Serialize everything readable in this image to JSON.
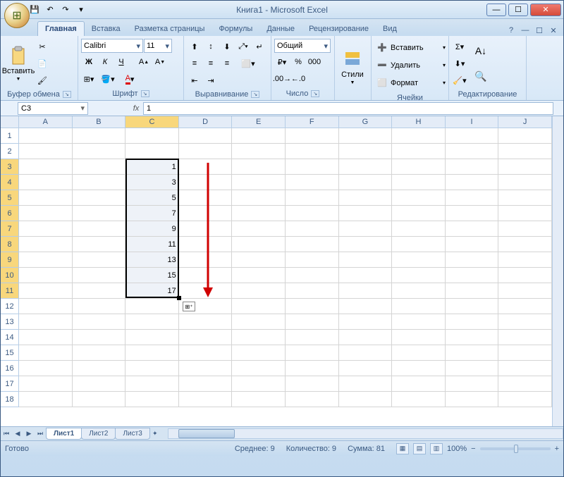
{
  "title": "Книга1 - Microsoft Excel",
  "tabs": [
    "Главная",
    "Вставка",
    "Разметка страницы",
    "Формулы",
    "Данные",
    "Рецензирование",
    "Вид"
  ],
  "activeTab": 0,
  "ribbon": {
    "clipboard": {
      "paste": "Вставить",
      "label": "Буфер обмена"
    },
    "font": {
      "family": "Calibri",
      "size": "11",
      "label": "Шрифт"
    },
    "alignment": {
      "label": "Выравнивание"
    },
    "number": {
      "format": "Общий",
      "label": "Число"
    },
    "styles": {
      "btn": "Стили"
    },
    "cells": {
      "insert": "Вставить",
      "delete": "Удалить",
      "format": "Формат",
      "label": "Ячейки"
    },
    "editing": {
      "label": "Редактирование"
    }
  },
  "namebox": "C3",
  "formula": "1",
  "columns": [
    "A",
    "B",
    "C",
    "D",
    "E",
    "F",
    "G",
    "H",
    "I",
    "J"
  ],
  "rowCount": 18,
  "selectedCol": 2,
  "selection": {
    "col": 2,
    "rowStart": 3,
    "rowEnd": 11
  },
  "cellData": {
    "C3": "1",
    "C4": "3",
    "C5": "5",
    "C6": "7",
    "C7": "9",
    "C8": "11",
    "C9": "13",
    "C10": "15",
    "C11": "17"
  },
  "sheets": [
    "Лист1",
    "Лист2",
    "Лист3"
  ],
  "activeSheet": 0,
  "status": {
    "ready": "Готово",
    "avg": "Среднее: 9",
    "count": "Количество: 9",
    "sum": "Сумма: 81",
    "zoom": "100%"
  }
}
